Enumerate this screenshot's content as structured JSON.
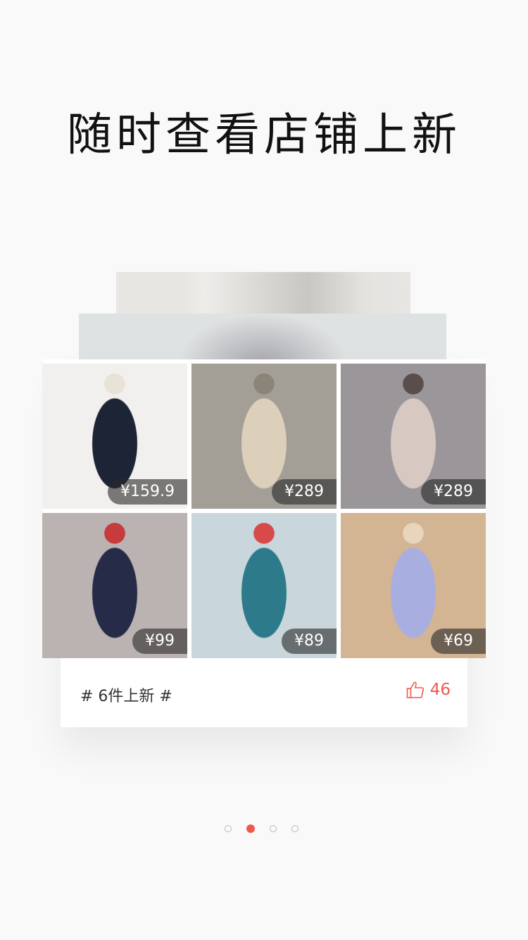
{
  "title": "随时查看店铺上新",
  "products": [
    {
      "price": "¥159.9",
      "colors": [
        "#f2f0ee",
        "#1d2435",
        "#e8e2d8"
      ]
    },
    {
      "price": "¥289",
      "colors": [
        "#a49f96",
        "#dcd0bb",
        "#8b8579"
      ]
    },
    {
      "price": "¥289",
      "colors": [
        "#9a969a",
        "#d7c9c2",
        "#5a4e4c"
      ]
    },
    {
      "price": "¥99",
      "colors": [
        "#bbb3b1",
        "#262b48",
        "#c63b3b"
      ]
    },
    {
      "price": "¥89",
      "colors": [
        "#c9d7dc",
        "#2d7a8a",
        "#d84a4a"
      ]
    },
    {
      "price": "¥69",
      "colors": [
        "#d3b493",
        "#a9aee0",
        "#e9d4bd"
      ]
    }
  ],
  "footer": {
    "tag": "# 6件上新 #",
    "likes": "46"
  },
  "pagination": {
    "count": 4,
    "active": 1
  },
  "accent": "#f0594a"
}
